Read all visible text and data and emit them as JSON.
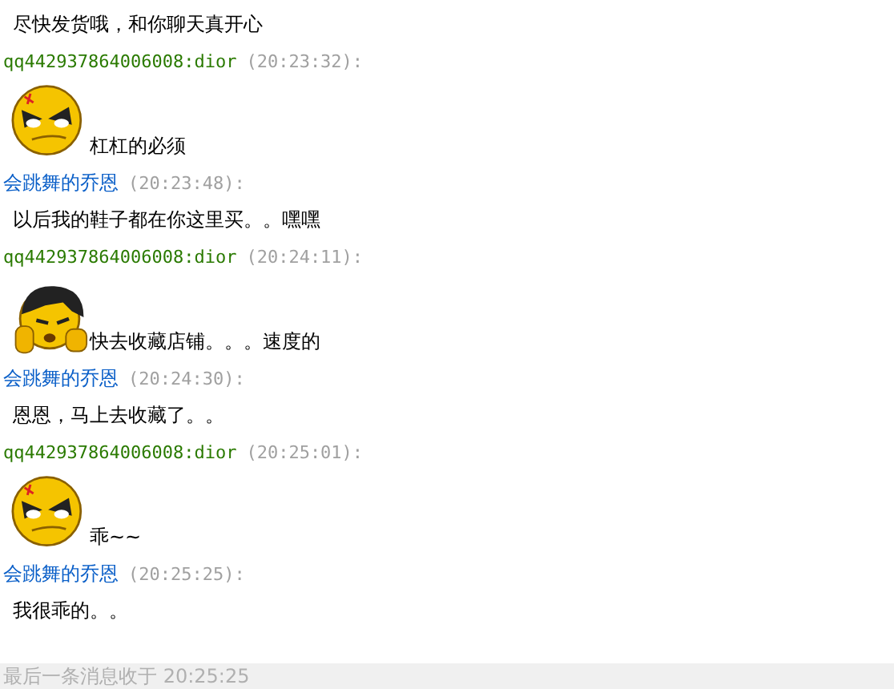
{
  "messages": [
    {
      "text": "尽快发货哦，和你聊天真开心"
    },
    {
      "kind": "buyer",
      "sender": "qq442937864006008:dior",
      "time": "(20:23:32):",
      "emoticon": {
        "kind": "scowl"
      },
      "text": "杠杠的必须"
    },
    {
      "kind": "seller",
      "sender": "会跳舞的乔恩",
      "time": "(20:23:48):",
      "text": "以后我的鞋子都在你这里买。。嘿嘿"
    },
    {
      "kind": "buyer",
      "sender": "qq442937864006008:dior",
      "time": "(20:24:11):",
      "emoticon": {
        "kind": "hair"
      },
      "text": "快去收藏店铺。。。速度的"
    },
    {
      "kind": "seller",
      "sender": "会跳舞的乔恩",
      "time": "(20:24:30):",
      "text": "恩恩，马上去收藏了。。"
    },
    {
      "kind": "buyer",
      "sender": "qq442937864006008:dior",
      "time": "(20:25:01):",
      "emoticon": {
        "kind": "scowl"
      },
      "text": "乖~~"
    },
    {
      "kind": "seller",
      "sender": "会跳舞的乔恩",
      "time": "(20:25:25):",
      "text": "我很乖的。。"
    }
  ],
  "footer": "最后一条消息收于 20:25:25"
}
